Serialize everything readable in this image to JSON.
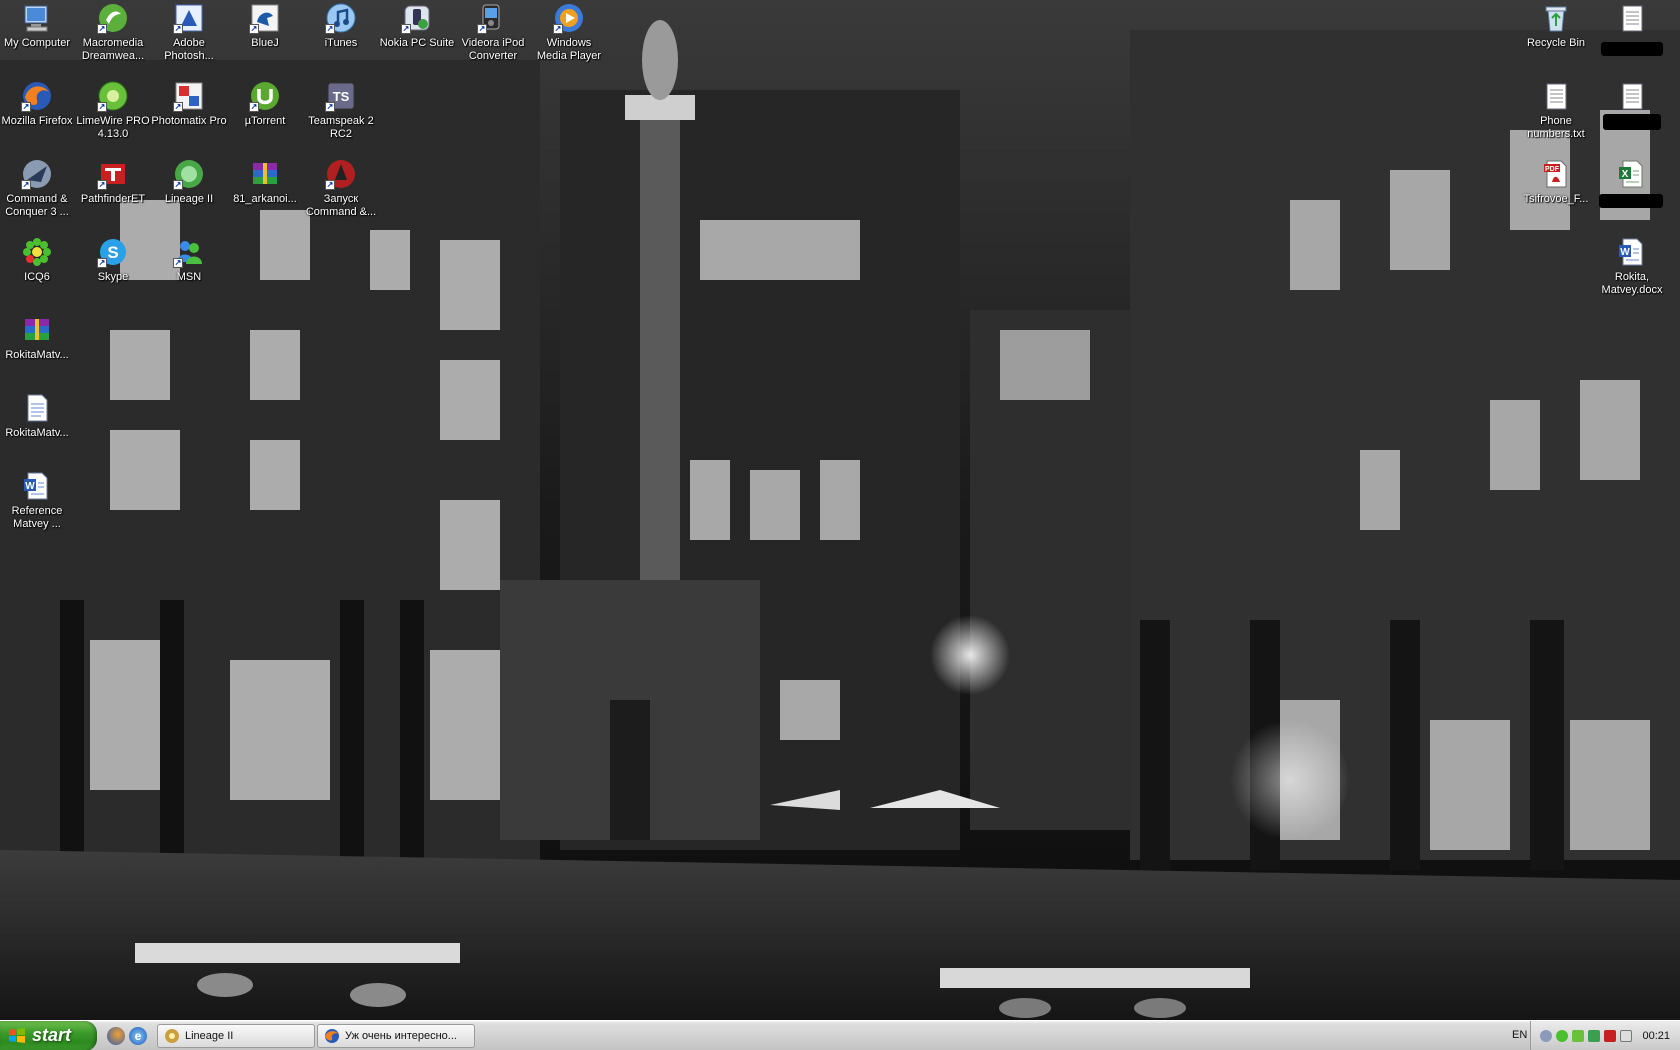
{
  "desktop": {
    "icons": [
      {
        "label": "My Computer",
        "icon": "my-computer-icon"
      },
      {
        "label": "Macromedia Dreamwea...",
        "icon": "dreamweaver-icon"
      },
      {
        "label": "Adobe Photosh...",
        "icon": "photoshop-icon"
      },
      {
        "label": "BlueJ",
        "icon": "bluej-icon"
      },
      {
        "label": "iTunes",
        "icon": "itunes-icon"
      },
      {
        "label": "Nokia PC Suite",
        "icon": "nokia-pc-suite-icon"
      },
      {
        "label": "Videora iPod Converter",
        "icon": "videora-icon"
      },
      {
        "label": "Windows Media Player",
        "icon": "windows-media-player-icon"
      },
      {
        "label": "Mozilla Firefox",
        "icon": "firefox-icon"
      },
      {
        "label": "LimeWire PRO 4.13.0",
        "icon": "limewire-icon"
      },
      {
        "label": "Photomatix Pro",
        "icon": "photomatix-icon"
      },
      {
        "label": "µTorrent",
        "icon": "utorrent-icon"
      },
      {
        "label": "Teamspeak 2 RC2",
        "icon": "teamspeak-icon"
      },
      {
        "label": "Command & Conquer 3 ...",
        "icon": "command-conquer-icon"
      },
      {
        "label": "PathfinderET",
        "icon": "pathfinder-icon"
      },
      {
        "label": "Lineage II",
        "icon": "lineage-icon"
      },
      {
        "label": "81_arkanoi...",
        "icon": "winrar-archive-icon"
      },
      {
        "label": "Запуск Command &...",
        "icon": "command-conquer-launch-icon"
      },
      {
        "label": "ICQ6",
        "icon": "icq-icon"
      },
      {
        "label": "Skype",
        "icon": "skype-icon"
      },
      {
        "label": "MSN",
        "icon": "msn-icon"
      },
      {
        "label": "RokitaMatv...",
        "icon": "winrar-archive-icon"
      },
      {
        "label": "RokitaMatv...",
        "icon": "text-document-icon"
      },
      {
        "label": "Reference Matvey ...",
        "icon": "word-document-icon"
      }
    ],
    "right_icons": [
      {
        "label": "Recycle Bin",
        "icon": "recycle-bin-icon"
      },
      {
        "label": "",
        "icon": "notepad-document-icon"
      },
      {
        "label": "Phone numbers.txt",
        "icon": "notepad-document-icon"
      },
      {
        "label": "",
        "icon": "notepad-document-icon"
      },
      {
        "label": "Tsifrovoe_F...",
        "icon": "pdf-document-icon"
      },
      {
        "label": "",
        "icon": "excel-document-icon"
      },
      {
        "label": "Rokita, Matvey.docx",
        "icon": "word-document-icon"
      }
    ]
  },
  "taskbar": {
    "start_label": "start",
    "tasks": [
      {
        "label": "Lineage II",
        "icon": "lineage-icon"
      },
      {
        "label": "Уж очень интересно...",
        "icon": "firefox-icon"
      }
    ],
    "language": "EN",
    "clock": "00:21"
  },
  "colors": {
    "start_green": "#3c9a2a",
    "taskbar_silver": "#d2d2d2"
  }
}
